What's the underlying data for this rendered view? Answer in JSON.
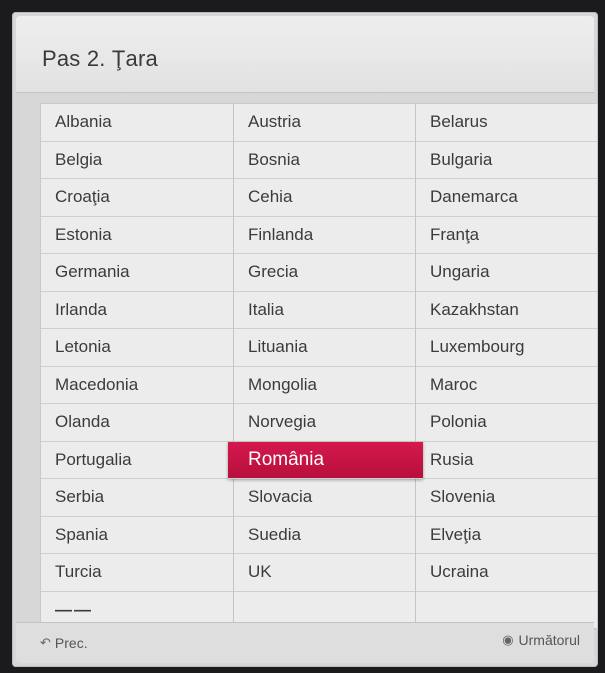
{
  "header": {
    "title": "Pas 2. Ţara"
  },
  "countries": {
    "col1": [
      "Albania",
      "Belgia",
      "Croaţia",
      "Estonia",
      "Germania",
      "Irlanda",
      "Letonia",
      "Macedonia",
      "Olanda",
      "Portugalia",
      "Serbia",
      "Spania",
      "Turcia",
      "——"
    ],
    "col2": [
      "Austria",
      "Bosnia",
      "Cehia",
      "Finlanda",
      "Grecia",
      "Italia",
      "Lituania",
      "Mongolia",
      "Norvegia",
      "România",
      "Slovacia",
      "Suedia",
      "UK",
      ""
    ],
    "col3": [
      "Belarus",
      "Bulgaria",
      "Danemarca",
      "Franţa",
      "Ungaria",
      "Kazakhstan",
      "Luxembourg",
      "Maroc",
      "Polonia",
      "Rusia",
      "Slovenia",
      "Elveţia",
      "Ucraina",
      ""
    ]
  },
  "selected": "România",
  "footer": {
    "prev_icon": "back-arrow-icon",
    "prev_label": "Prec.",
    "next_icon": "ok-button-icon",
    "next_label": "Următorul"
  },
  "colors": {
    "selection": "#c5144a",
    "panel": "#e9e9e9"
  }
}
